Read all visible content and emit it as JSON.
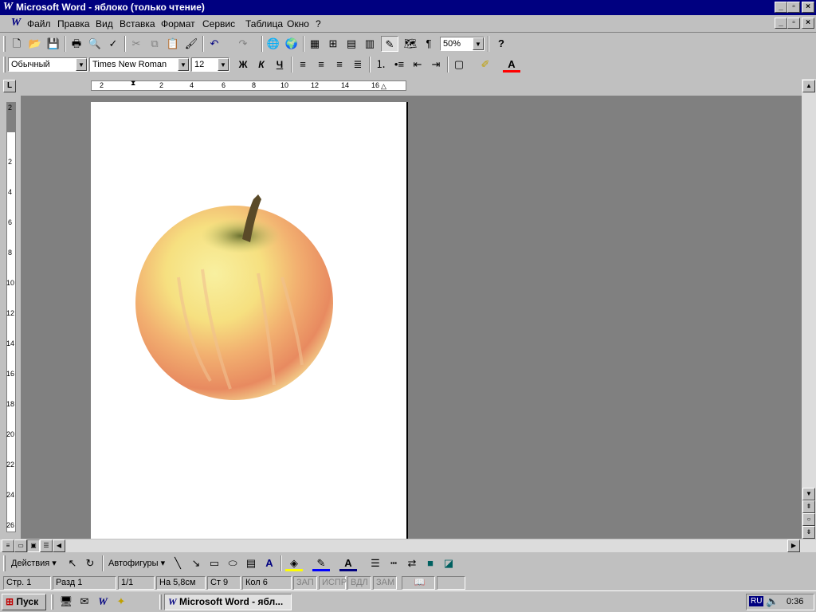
{
  "window": {
    "title": "Microsoft Word - яблоко (только чтение)"
  },
  "caption_buttons": {
    "minimize": "_",
    "maximize": "▫",
    "close": "×"
  },
  "menu": [
    "Файл",
    "Правка",
    "Вид",
    "Вставка",
    "Формат",
    "Сервис",
    "Таблица",
    "Окно",
    "?"
  ],
  "standard_toolbar": {
    "zoom": "50%",
    "help": "?",
    "pilcrow": "¶"
  },
  "format_toolbar": {
    "style": "Обычный",
    "font": "Times New Roman",
    "size": "12",
    "bold": "Ж",
    "italic": "К",
    "underline": "Ч",
    "font_color_letter": "A"
  },
  "ruler": {
    "h_labels": [
      "2",
      "2",
      "4",
      "6",
      "8",
      "10",
      "12",
      "14",
      "16"
    ],
    "v_labels": [
      "2",
      "2",
      "4",
      "6",
      "8",
      "10",
      "12",
      "14",
      "16",
      "18",
      "20",
      "22",
      "24",
      "26"
    ]
  },
  "drawing_toolbar": {
    "actions": "Действия",
    "autoshapes": "Автофигуры"
  },
  "status": {
    "page": "Стр. 1",
    "section": "Разд 1",
    "pages": "1/1",
    "at": "На 5,8см",
    "line": "Ст 9",
    "col": "Кол 6",
    "rec": "ЗАП",
    "trk": "ИСПР",
    "ext": "ВДЛ",
    "ovr": "ЗАМ"
  },
  "taskbar": {
    "start": "Пуск",
    "task": "Microsoft Word - ябл...",
    "lang": "RU",
    "clock": "0:36"
  },
  "colors": {
    "titlebar": "#000080",
    "face": "#c0c0c0",
    "workspace": "#808080"
  }
}
